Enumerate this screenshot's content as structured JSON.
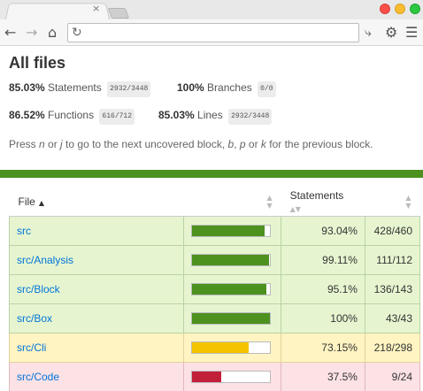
{
  "browser": {
    "tab_close_glyph": "×",
    "address": ""
  },
  "page": {
    "title": "All files",
    "stats": [
      {
        "pct": "85.03%",
        "label": "Statements",
        "fraction": "2932/3448"
      },
      {
        "pct": "100%",
        "label": "Branches",
        "fraction": "0/0"
      },
      {
        "pct": "86.52%",
        "label": "Functions",
        "fraction": "616/712"
      },
      {
        "pct": "85.03%",
        "label": "Lines",
        "fraction": "2932/3448"
      }
    ],
    "hint_parts": [
      "Press ",
      "n",
      " or ",
      "j",
      " to go to the next uncovered block, ",
      "b",
      ", ",
      "p",
      " or ",
      "k",
      " for the previous block."
    ],
    "colors": {
      "high": "#4d911f",
      "medium": "#f5c400",
      "low": "#c21f39"
    }
  },
  "table": {
    "headers": {
      "file": "File",
      "statements": "Statements"
    },
    "rows": [
      {
        "file": "src",
        "level": "high",
        "coverage": 0.9304,
        "pct": "93.04%",
        "abs": "428/460"
      },
      {
        "file": "src/Analysis",
        "level": "high",
        "coverage": 0.9911,
        "pct": "99.11%",
        "abs": "111/112"
      },
      {
        "file": "src/Block",
        "level": "high",
        "coverage": 0.951,
        "pct": "95.1%",
        "abs": "136/143"
      },
      {
        "file": "src/Box",
        "level": "high",
        "coverage": 1.0,
        "pct": "100%",
        "abs": "43/43"
      },
      {
        "file": "src/Cli",
        "level": "medium",
        "coverage": 0.7315,
        "pct": "73.15%",
        "abs": "218/298"
      },
      {
        "file": "src/Code",
        "level": "low",
        "coverage": 0.375,
        "pct": "37.5%",
        "abs": "9/24"
      }
    ]
  }
}
